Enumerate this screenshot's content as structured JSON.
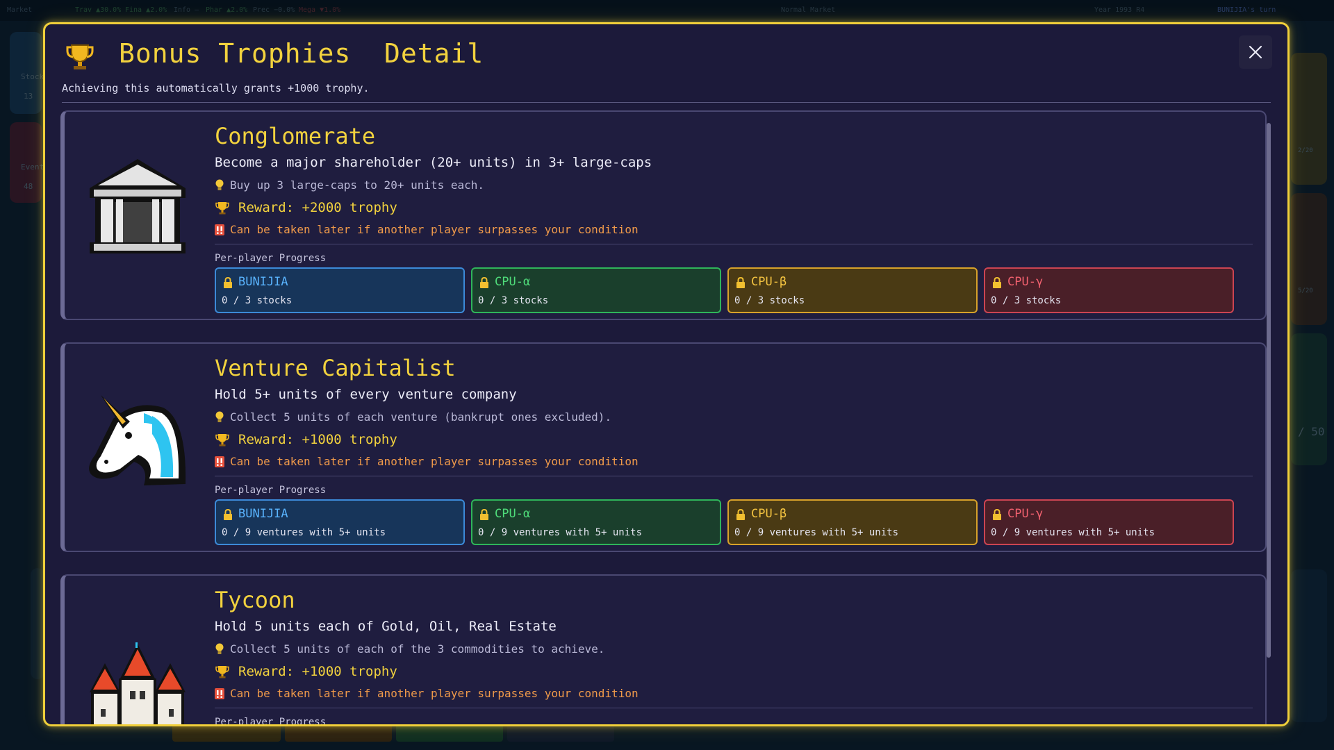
{
  "background": {
    "topbar_items": [
      "Market",
      "Trav ▲30.0%",
      "Fina ▲2.0%",
      "Info —",
      "Phar ▲2.0%",
      "Prec −0.0%",
      "Mega ▼1.0%",
      "Normal Market",
      "Year 1993 R4",
      "BUNIJIA's turn"
    ],
    "side_labels": [
      "Stock",
      "13",
      "Event",
      "48",
      "2/20",
      "5/20",
      "/ 50"
    ]
  },
  "modal": {
    "title": "Bonus Trophies  Detail",
    "subtitle": "Achieving this automatically grants +1000 trophy.",
    "progress_label": "Per-player Progress"
  },
  "trophies": [
    {
      "title": "Conglomerate",
      "description": "Become a major shareholder (20+ units) in 3+ large-caps",
      "hint": "Buy up 3 large-caps to 20+ units each.",
      "reward": "Reward: +2000 trophy",
      "warning": "Can be taken later if another player surpasses your condition",
      "icon": "bank-building-icon",
      "players": [
        {
          "name": "BUNIJIA",
          "progress": "0 / 3 stocks"
        },
        {
          "name": "CPU-α",
          "progress": "0 / 3 stocks"
        },
        {
          "name": "CPU-β",
          "progress": "0 / 3 stocks"
        },
        {
          "name": "CPU-γ",
          "progress": "0 / 3 stocks"
        }
      ]
    },
    {
      "title": "Venture Capitalist",
      "description": "Hold 5+ units of every venture company",
      "hint": "Collect 5 units of each venture (bankrupt ones excluded).",
      "reward": "Reward: +1000 trophy",
      "warning": "Can be taken later if another player surpasses your condition",
      "icon": "unicorn-icon",
      "players": [
        {
          "name": "BUNIJIA",
          "progress": "0 / 9 ventures with 5+ units"
        },
        {
          "name": "CPU-α",
          "progress": "0 / 9 ventures with 5+ units"
        },
        {
          "name": "CPU-β",
          "progress": "0 / 9 ventures with 5+ units"
        },
        {
          "name": "CPU-γ",
          "progress": "0 / 9 ventures with 5+ units"
        }
      ]
    },
    {
      "title": "Tycoon",
      "description": "Hold 5 units each of Gold, Oil, Real Estate",
      "hint": "Collect 5 units of each of the 3 commodities to achieve.",
      "reward": "Reward: +1000 trophy",
      "warning": "Can be taken later if another player surpasses your condition",
      "icon": "castle-icon",
      "players": []
    }
  ],
  "colors": {
    "accent": "#f2d23e",
    "player_bunijia": "#3c8ad8",
    "player_cpu_alpha": "#2fb45a",
    "player_cpu_beta": "#d8a22a",
    "player_cpu_gamma": "#cc4452"
  }
}
